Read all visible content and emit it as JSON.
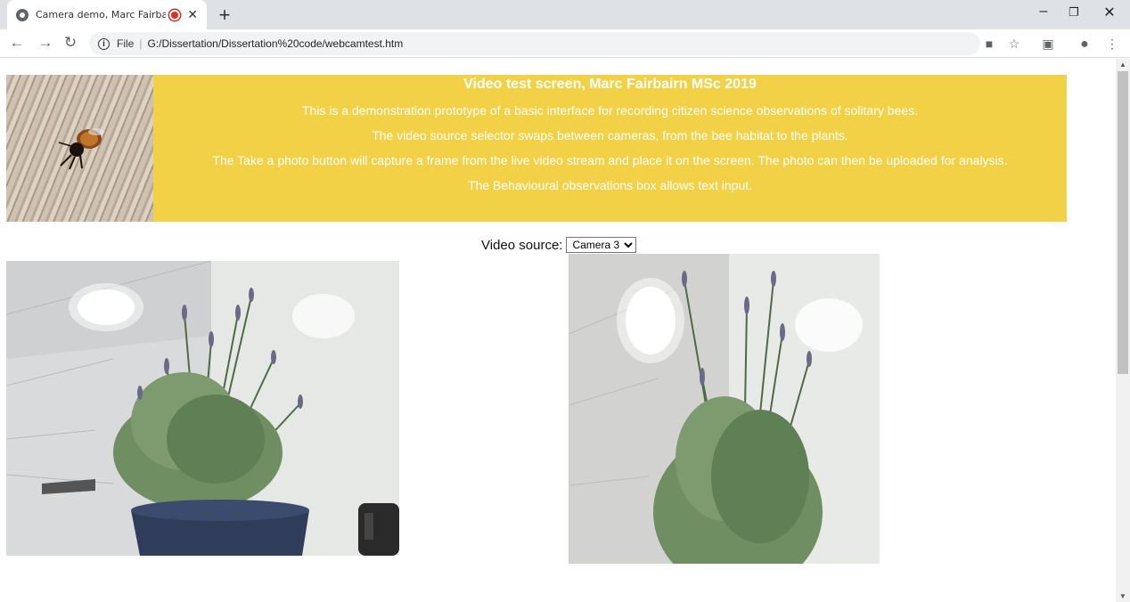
{
  "browser": {
    "tab_title": "Camera demo, Marc Fairbairn",
    "url_scheme_label": "File",
    "url": "G:/Dissertation/Dissertation%20code/webcamtest.htm"
  },
  "banner": {
    "title": "Video test screen, Marc Fairbairn MSc 2019",
    "lines": [
      "This is a demonstration prototype of a basic interface for recording citizen science observations of solitary bees.",
      "The video source selector swaps between cameras, from the bee habitat to the plants.",
      "The Take a photo button will capture a frame from the live video stream and place it on the screen. The photo can then be uploaded for analysis.",
      "The Behavioural observations box allows text input."
    ],
    "bg_color": "#f3d147"
  },
  "video_source": {
    "label": "Video source:",
    "selected": "Camera 3"
  }
}
